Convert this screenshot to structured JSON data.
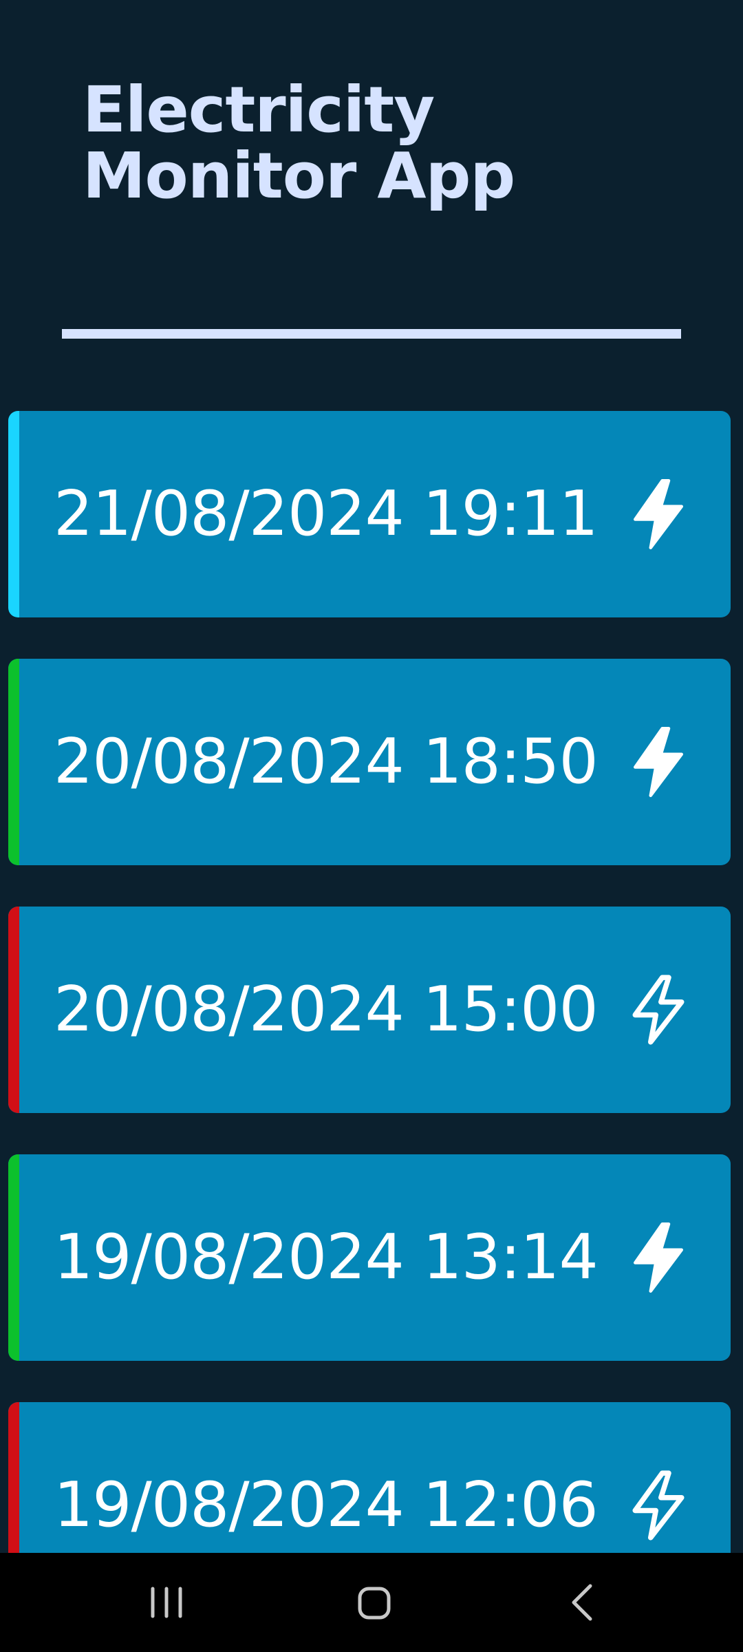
{
  "app": {
    "title": "Electricity Monitor App"
  },
  "colors": {
    "background": "#0b202e",
    "title": "#d6e3ff",
    "card": "#0487b8",
    "stripe_cyan": "#1ad5ff",
    "stripe_green": "#0cc12c",
    "stripe_red": "#d10f16",
    "nav_bar": "#000000"
  },
  "readings": [
    {
      "timestamp": "21/08/2024 19:11",
      "status_color": "#1ad5ff",
      "icon": "bolt-filled-icon"
    },
    {
      "timestamp": "20/08/2024 18:50",
      "status_color": "#0cc12c",
      "icon": "bolt-filled-icon"
    },
    {
      "timestamp": "20/08/2024 15:00",
      "status_color": "#d10f16",
      "icon": "bolt-outline-icon"
    },
    {
      "timestamp": "19/08/2024 13:14",
      "status_color": "#0cc12c",
      "icon": "bolt-filled-icon"
    },
    {
      "timestamp": "19/08/2024 12:06",
      "status_color": "#d10f16",
      "icon": "bolt-outline-icon"
    }
  ],
  "navigation": {
    "recents_icon": "recents-icon",
    "home_icon": "home-icon",
    "back_icon": "back-icon"
  }
}
